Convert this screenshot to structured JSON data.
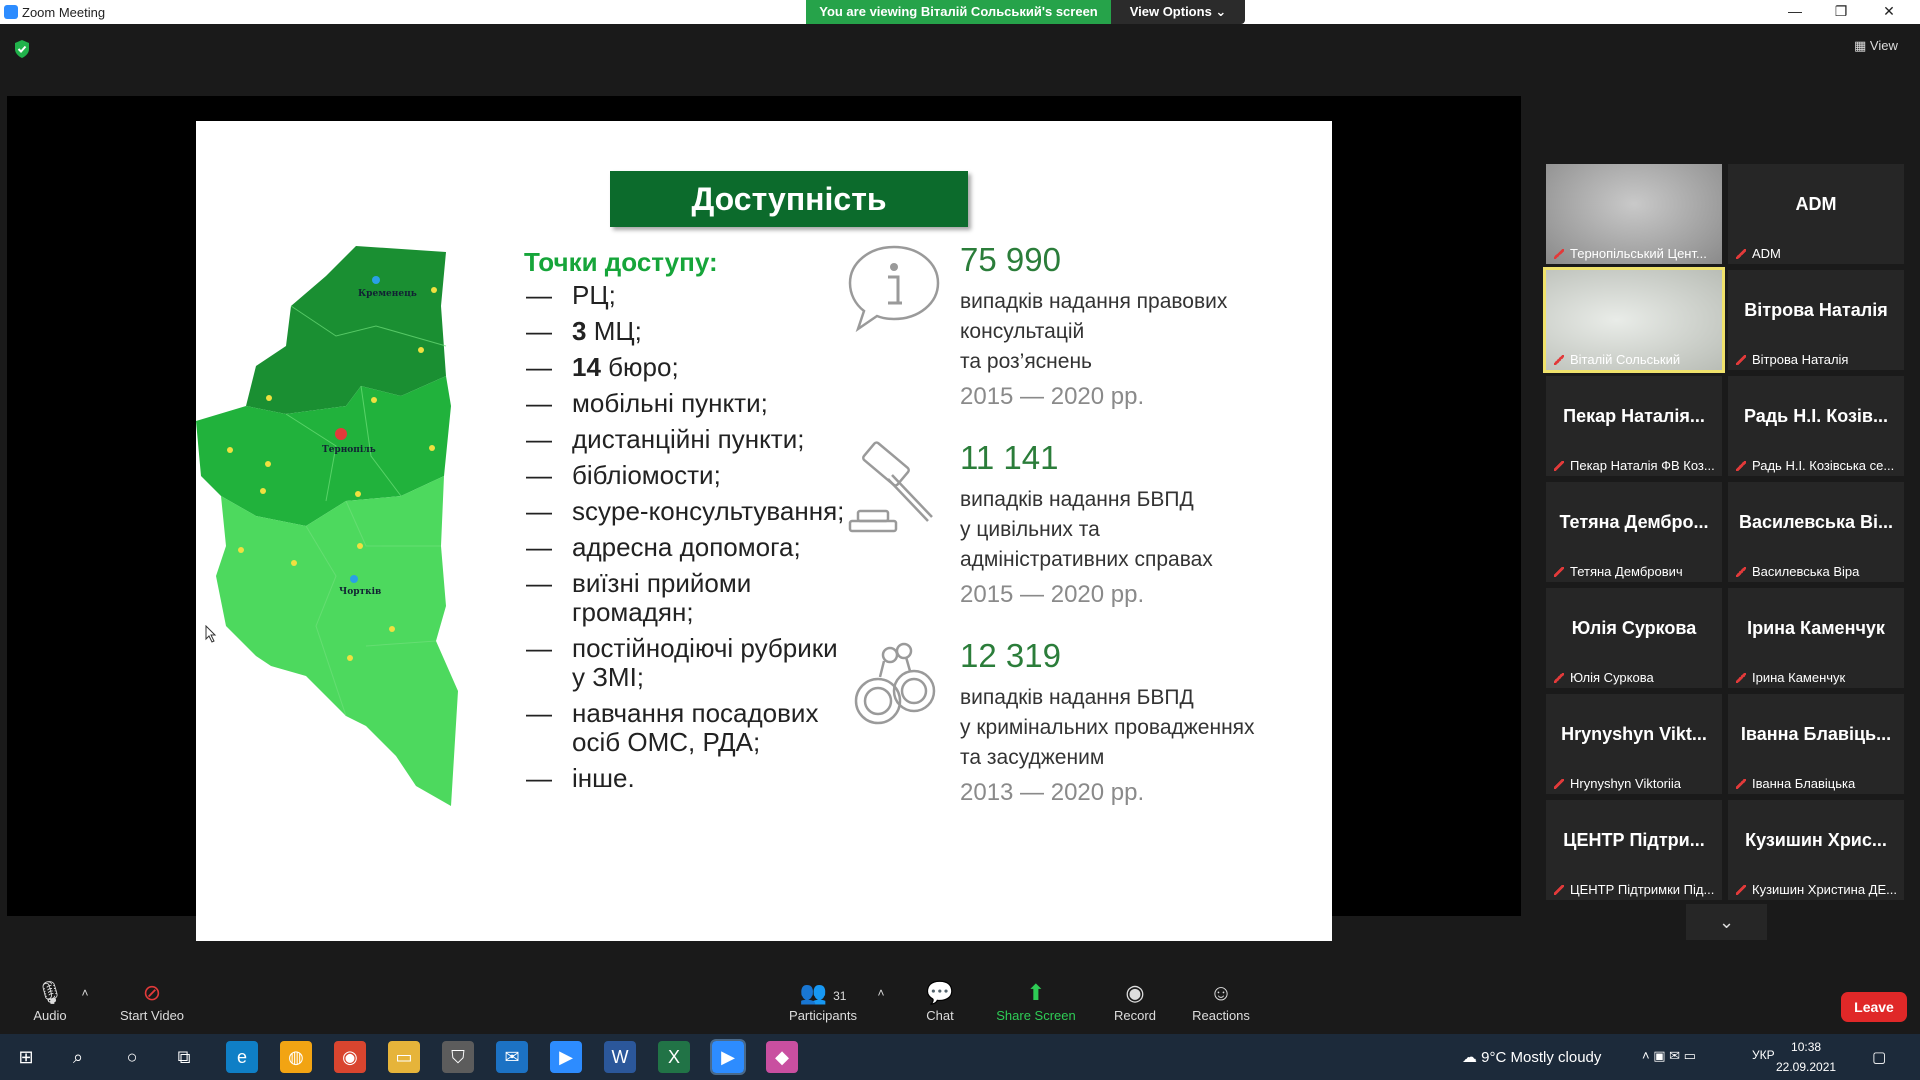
{
  "window": {
    "title": "Zoom Meeting",
    "viewing_banner": "You are viewing Віталій Сольський's screen",
    "view_options": "View Options ⌄",
    "minimize": "—",
    "maximize": "❐",
    "close": "✕",
    "view_button": "View"
  },
  "slide": {
    "title": "Доступність",
    "map_labels": {
      "north": "Кременець",
      "center": "Тернопіль",
      "south": "Чортків"
    },
    "access_heading": "Точки доступу:",
    "access_items": [
      {
        "bold": "",
        "text": "РЦ;"
      },
      {
        "bold": "3",
        "text": " МЦ;"
      },
      {
        "bold": "14",
        "text": " бюро;"
      },
      {
        "bold": "",
        "text": "мобільні пункти;"
      },
      {
        "bold": "",
        "text": "дистанційні пункти;"
      },
      {
        "bold": "",
        "text": "бібліомости;"
      },
      {
        "bold": "",
        "text": "scype-консультування;"
      },
      {
        "bold": "",
        "text": "адресна допомога;"
      },
      {
        "bold": "",
        "text": "виїзні прийоми громадян;"
      },
      {
        "bold": "",
        "text": "постійнодіючі рубрики у ЗМІ;"
      },
      {
        "bold": "",
        "text": "навчання посадових осіб ОМС, РДА;"
      },
      {
        "bold": "",
        "text": "інше."
      }
    ],
    "dash": "—",
    "stats": [
      {
        "icon": "info-bubble-icon",
        "number": "75 990",
        "desc": [
          "випадків надання правових",
          "консультацій",
          "та роз’яснень"
        ],
        "years": "2015 — 2020 рр."
      },
      {
        "icon": "gavel-icon",
        "number": "11 141",
        "desc": [
          "випадків надання БВПД",
          "у цивільних та",
          "адміністративних справах"
        ],
        "years": "2015 — 2020 рр."
      },
      {
        "icon": "handcuffs-icon",
        "number": "12 319",
        "desc": [
          "випадків надання БВПД",
          "у кримінальних провадженнях",
          "та засудженим"
        ],
        "years": "2013 — 2020 рр."
      }
    ]
  },
  "participants": [
    {
      "display": "",
      "label": "Тернопільський Цент...",
      "photo": true,
      "active": false
    },
    {
      "display": "ADM",
      "label": "ADM",
      "photo": false,
      "active": false
    },
    {
      "display": "",
      "label": "Віталій Сольський",
      "photo": true,
      "active": true
    },
    {
      "display": "Вітрова Наталія",
      "label": "Вітрова Наталія",
      "photo": false,
      "active": false
    },
    {
      "display": "Пекар Наталія...",
      "label": "Пекар Наталія ФВ Коз...",
      "photo": false,
      "active": false
    },
    {
      "display": "Радь Н.І. Козів...",
      "label": "Радь Н.І. Козівська се...",
      "photo": false,
      "active": false
    },
    {
      "display": "Тетяна Дембро...",
      "label": "Тетяна Дембрович",
      "photo": false,
      "active": false
    },
    {
      "display": "Василевська Ві...",
      "label": "Василевська Віра",
      "photo": false,
      "active": false
    },
    {
      "display": "Юлія Суркова",
      "label": "Юлія Суркова",
      "photo": false,
      "active": false
    },
    {
      "display": "Ірина Каменчук",
      "label": "Ірина Каменчук",
      "photo": false,
      "active": false
    },
    {
      "display": "Hrynyshyn Vikt...",
      "label": "Hrynyshyn Viktoriia",
      "photo": false,
      "active": false
    },
    {
      "display": "Іванна Блавіць...",
      "label": "Іванна Блавіцька",
      "photo": false,
      "active": false
    },
    {
      "display": "ЦЕНТР Підтри...",
      "label": "ЦЕНТР Підтримки Під...",
      "photo": false,
      "active": false
    },
    {
      "display": "Кузишин Хрис...",
      "label": "Кузишин Христина ДЕ...",
      "photo": false,
      "active": false
    }
  ],
  "toolbar": {
    "audio": "Audio",
    "start_video": "Start Video",
    "participants": "Participants",
    "participants_count": "31",
    "chat": "Chat",
    "share_screen": "Share Screen",
    "record": "Record",
    "reactions": "Reactions",
    "leave": "Leave",
    "more_arrow": "⌄"
  },
  "taskbar": {
    "weather": "9°C  Mostly cloudy",
    "language": "УКР",
    "time": "10:38",
    "date": "22.09.2021"
  },
  "colors": {
    "slide_green": "#0c6b2c",
    "heading_green": "#16a53a",
    "number_green": "#2b7d3a",
    "share_green": "#26a34a",
    "leave_red": "#e02828"
  }
}
